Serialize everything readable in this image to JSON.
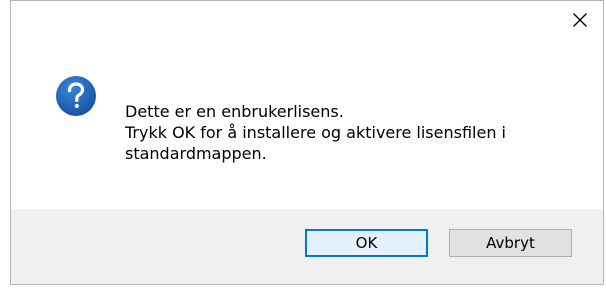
{
  "dialog": {
    "close_icon": "close-icon",
    "question_icon": "question-icon",
    "icon_color": "#1c5db5",
    "message_lines": [
      "Dette er en enbrukerlisens.",
      "Trykk OK for å installere og aktivere lisensfilen i",
      "standardmappen."
    ],
    "ok_label": "OK",
    "cancel_label": "Avbryt",
    "accent_color": "#0078d7"
  }
}
